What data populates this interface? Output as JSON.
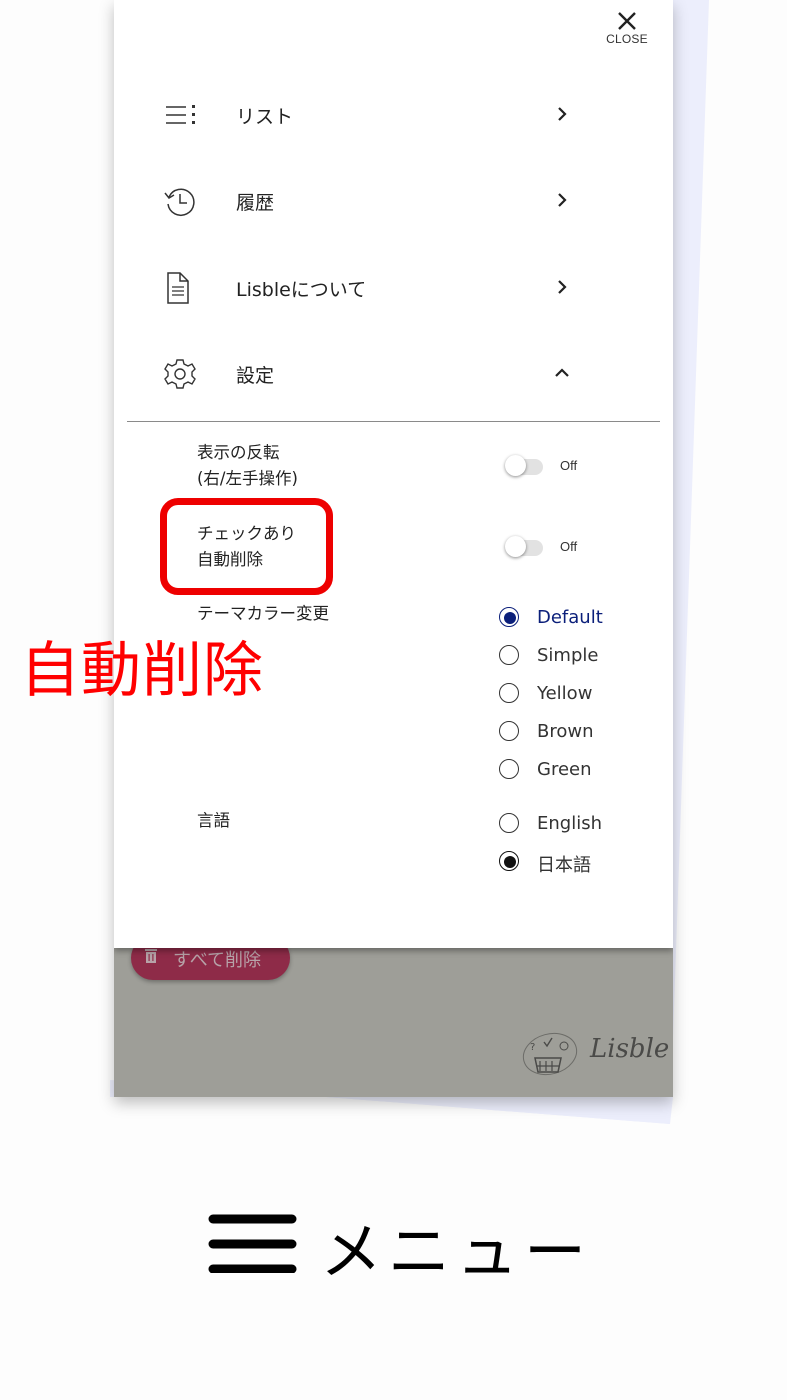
{
  "drawer": {
    "close_label": "CLOSE",
    "menu_items": [
      {
        "label": "リスト",
        "icon": "list-icon",
        "chevron": "chevron-right"
      },
      {
        "label": "履歴",
        "icon": "history-icon",
        "chevron": "chevron-right"
      },
      {
        "label": "Lisbleについて",
        "icon": "document-icon",
        "chevron": "chevron-right"
      },
      {
        "label": "設定",
        "icon": "gear-icon",
        "chevron": "chevron-up"
      }
    ],
    "settings": {
      "flip_display": {
        "label_line1": "表示の反転",
        "label_line2": "(右/左手操作)",
        "state": "Off"
      },
      "auto_delete_checked": {
        "label_line1": "チェックあり",
        "label_line2": "自動削除",
        "state": "Off"
      },
      "theme_color": {
        "label": "テーマカラー変更",
        "options": [
          "Default",
          "Simple",
          "Yellow",
          "Brown",
          "Green"
        ],
        "selected": "Default",
        "selected_color": "#0b1f7a"
      },
      "language": {
        "label": "言語",
        "options": [
          "English",
          "日本語"
        ],
        "selected": "日本語"
      }
    }
  },
  "background_app": {
    "delete_all_label": "すべて削除",
    "logo_text": "Lisble"
  },
  "annotation": {
    "callout_text": "自動削除",
    "color": "#ff0000"
  },
  "caption": {
    "text": "メニュー"
  }
}
